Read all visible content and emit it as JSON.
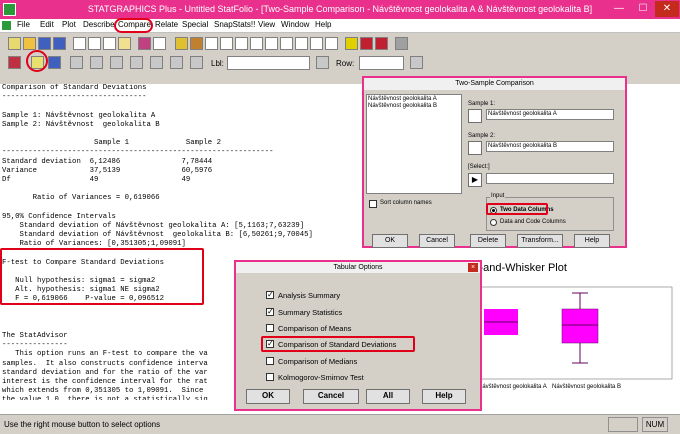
{
  "window": {
    "title": "STATGRAPHICS Plus - Untitled StatFolio - [Two-Sample Comparison - Návštěvnost geolokalita A & Návštěvnost  geolokalita B]",
    "min": "—",
    "max": "☐",
    "close": "✕"
  },
  "menu": [
    "File",
    "Edit",
    "Plot",
    "Describe",
    "Compare",
    "Relate",
    "Special",
    "SnapStats!!",
    "View",
    "Window",
    "Help"
  ],
  "toolbar2": {
    "lbl_label": "Lbl:",
    "row_label": "Row:"
  },
  "text_lines": [
    "Comparison of Standard Deviations",
    "---------------------------------",
    "",
    "Sample 1: Návštěvnost geolokalita A",
    "Sample 2: Návštěvnost  geolokalita B",
    "",
    "                     Sample 1             Sample 2",
    "--------------------------------------------------------------",
    "Standard deviation  6,12486              7,78444",
    "Variance            37,5139              60,5976",
    "Df                  49                   49",
    "",
    "       Ratio of Variances = 0,619066",
    "",
    "95,0% Confidence Intervals",
    "    Standard deviation of Návštěvnost geolokalita A: [5,1163;7,63239]",
    "    Standard deviation of Návštěvnost  geolokalita B: [6,50261;9,70045]",
    "    Ratio of Variances: [0,351305;1,09091]",
    "",
    "F-test to Compare Standard Deviations",
    "",
    "   Null hypothesis: sigma1 = sigma2",
    "   Alt. hypothesis: sigma1 NE sigma2",
    "   F = 0,619066    P-value = 0,096512",
    "",
    "",
    "",
    "The StatAdvisor",
    "---------------",
    "   This option runs an F-test to compare the va",
    "samples.  It also constructs confidence interva",
    "standard deviation and for the ratio of the var",
    "interest is the confidence interval for the rat",
    "which extends from 0,351305 to 1,09091.  Since",
    "the value 1.0, there is not a statistically sig"
  ],
  "chart": {
    "title_partial": "x-and-Whisker Plot",
    "x_labels": [
      "Návštěvnost geolokalita A",
      "Návštěvnost geolokalita B"
    ],
    "box_color": "#ff00ff"
  },
  "status": {
    "hint": "Use the right mouse button to select options",
    "num": "NUM"
  },
  "two_sample": {
    "title": "Two-Sample Comparison",
    "variables": [
      "Návštěvnost geolokalita A",
      "Návštěvnost  geolokalita B"
    ],
    "sample1_label": "Sample 1:",
    "sample1_value": "Návštěvnost geolokalita A",
    "sample2_label": "Sample 2:",
    "sample2_value": "Návštěvnost  geolokalita B",
    "select_label": "[Select:]",
    "sort_label": "Sort column names",
    "input_label": "Input",
    "opt1": "Two Data Columns",
    "opt2": "Data and Code Columns",
    "buttons": [
      "OK",
      "Cancel",
      "Delete",
      "Transform...",
      "Help"
    ]
  },
  "tabular": {
    "title": "Tabular Options",
    "options": [
      {
        "label": "Analysis Summary",
        "checked": true
      },
      {
        "label": "Summary Statistics",
        "checked": true
      },
      {
        "label": "Comparison of Means",
        "checked": false
      },
      {
        "label": "Comparison of Standard Deviations",
        "checked": true
      },
      {
        "label": "Comparison of Medians",
        "checked": false
      },
      {
        "label": "Kolmogorov-Smirnov Test",
        "checked": false
      }
    ],
    "buttons": [
      "OK",
      "Cancel",
      "All",
      "Help"
    ]
  },
  "colors": {
    "accent": "#e8308c",
    "highlight": "#e0001a"
  }
}
